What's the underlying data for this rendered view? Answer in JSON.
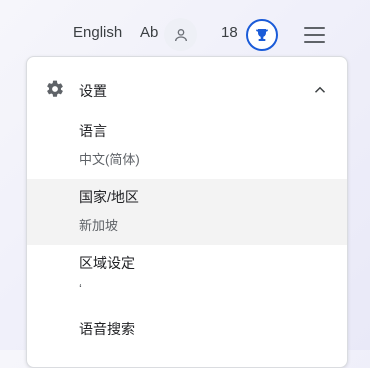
{
  "topbar": {
    "language_link": "English",
    "font_size_link": "Ab",
    "points_count": "18",
    "avatar_icon": "person-icon",
    "trophy_icon": "trophy-icon",
    "menu_icon": "hamburger-menu-icon"
  },
  "settings_panel": {
    "title": "设置",
    "icon": "gear-icon",
    "expand_icon": "chevron-up-icon",
    "items": [
      {
        "label": "语言",
        "value": "中文(简体)"
      },
      {
        "label": "国家/地区",
        "value": "新加坡"
      },
      {
        "label": "区域设定",
        "value": "‘"
      },
      {
        "label": "语音搜索",
        "value": ""
      }
    ]
  },
  "colors": {
    "accent": "#1a5bd8",
    "highlight_row": "#f3f3f3"
  }
}
